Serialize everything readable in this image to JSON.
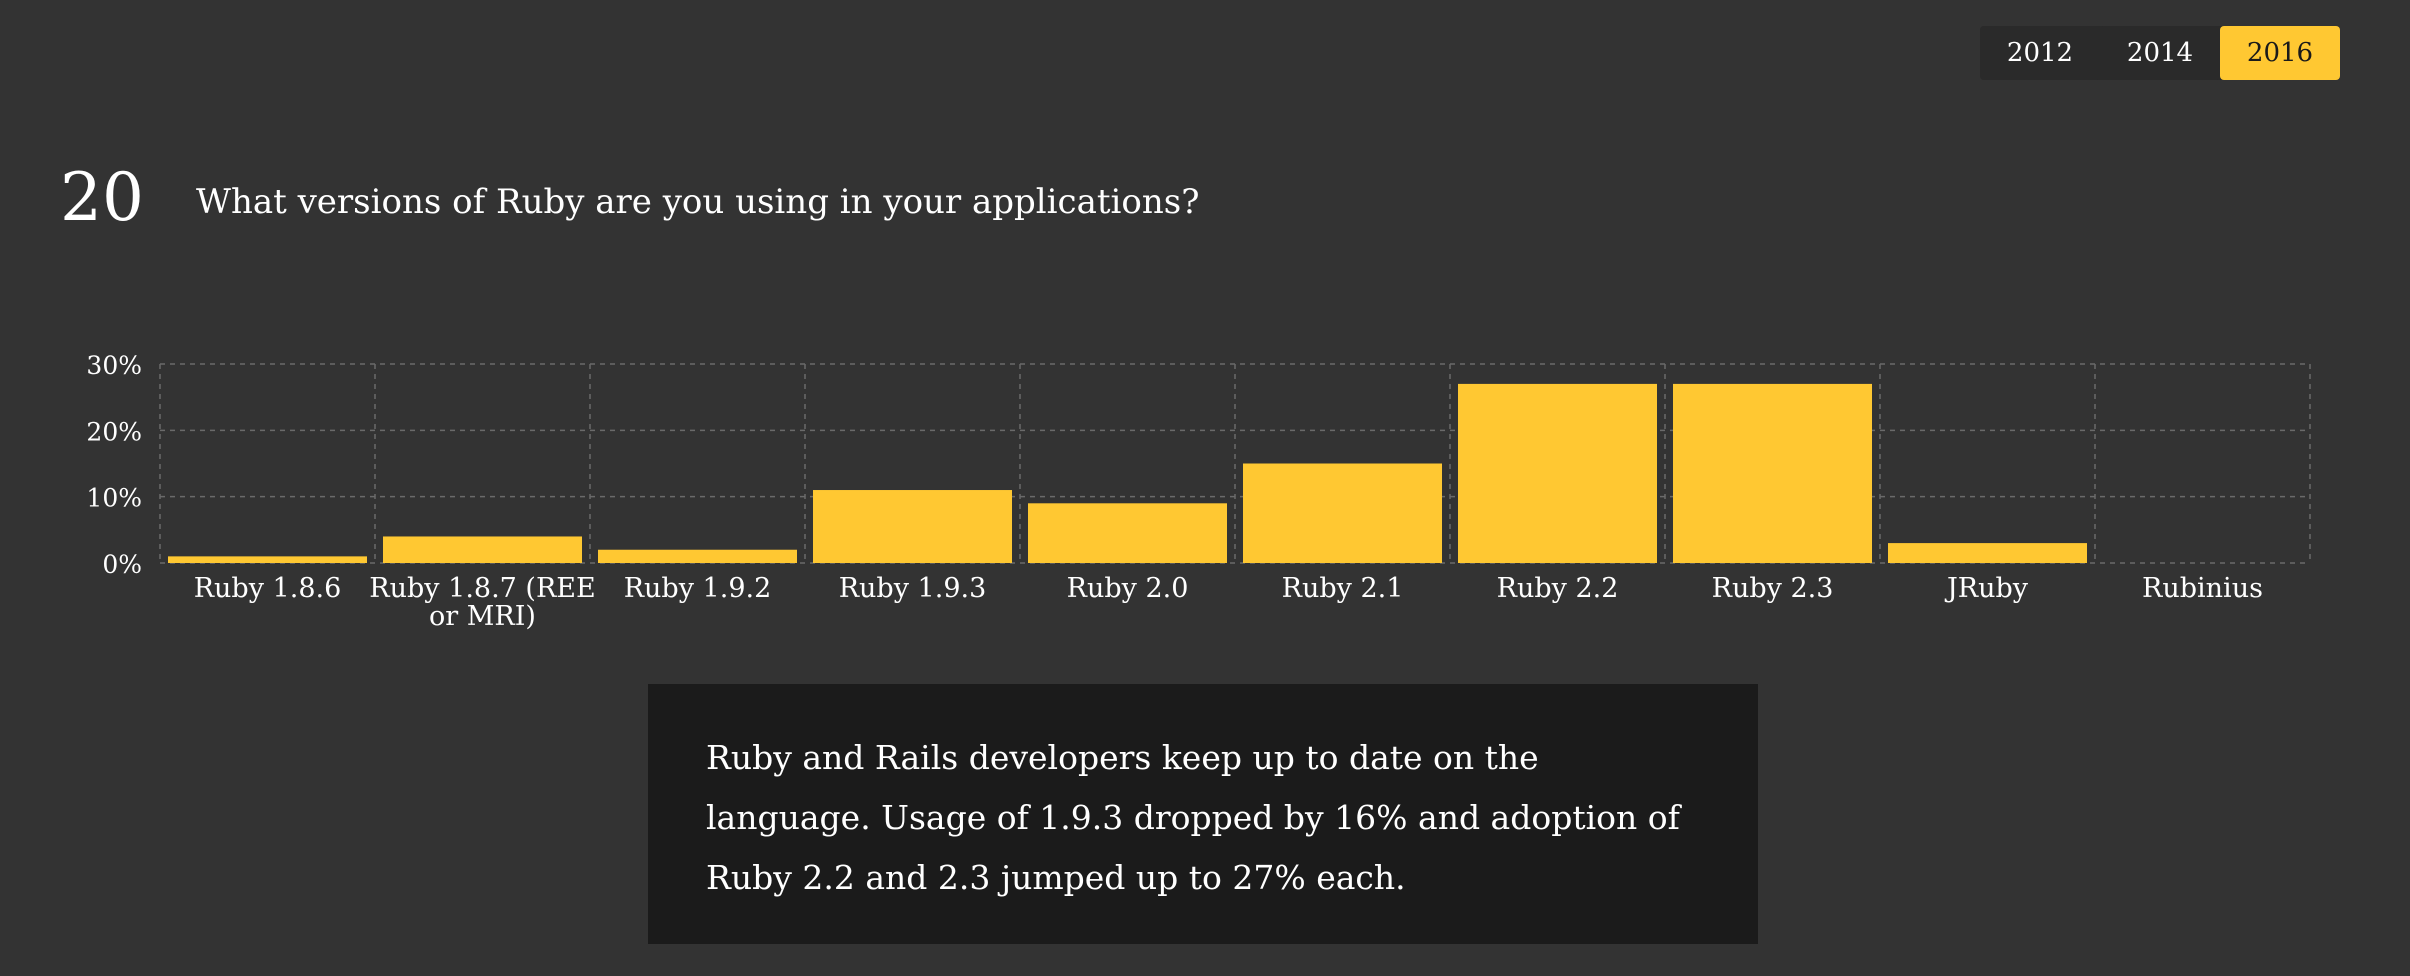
{
  "year_tabs": {
    "items": [
      {
        "label": "2012",
        "active": false
      },
      {
        "label": "2014",
        "active": false
      },
      {
        "label": "2016",
        "active": true
      }
    ],
    "accent_color": "#ffc832"
  },
  "question": {
    "number": "20",
    "text": "What versions of Ruby are you using in your applications?"
  },
  "chart_data": {
    "type": "bar",
    "categories": [
      "Ruby 1.8.6",
      "Ruby 1.8.7 (REE or MRI)",
      "Ruby 1.9.2",
      "Ruby 1.9.3",
      "Ruby 2.0",
      "Ruby 2.1",
      "Ruby 2.2",
      "Ruby 2.3",
      "JRuby",
      "Rubinius"
    ],
    "category_label_lines": [
      [
        "Ruby 1.8.6"
      ],
      [
        "Ruby 1.8.7 (REE",
        "or MRI)"
      ],
      [
        "Ruby 1.9.2"
      ],
      [
        "Ruby 1.9.3"
      ],
      [
        "Ruby 2.0"
      ],
      [
        "Ruby 2.1"
      ],
      [
        "Ruby 2.2"
      ],
      [
        "Ruby 2.3"
      ],
      [
        "JRuby"
      ],
      [
        "Rubinius"
      ]
    ],
    "values": [
      1,
      4,
      2,
      11,
      9,
      15,
      27,
      27,
      3,
      0
    ],
    "ylim": [
      0,
      30
    ],
    "yticks": [
      0,
      10,
      20,
      30
    ],
    "ytick_labels": [
      "0%",
      "10%",
      "20%",
      "30%"
    ],
    "grid": true,
    "bar_color": "#ffc832",
    "title": "",
    "xlabel": "",
    "ylabel": ""
  },
  "commentary": {
    "text": "Ruby and Rails developers keep up to date on the language. Usage of 1.9.3 dropped by 16% and adoption of Ruby 2.2 and 2.3 jumped up to 27% each."
  }
}
